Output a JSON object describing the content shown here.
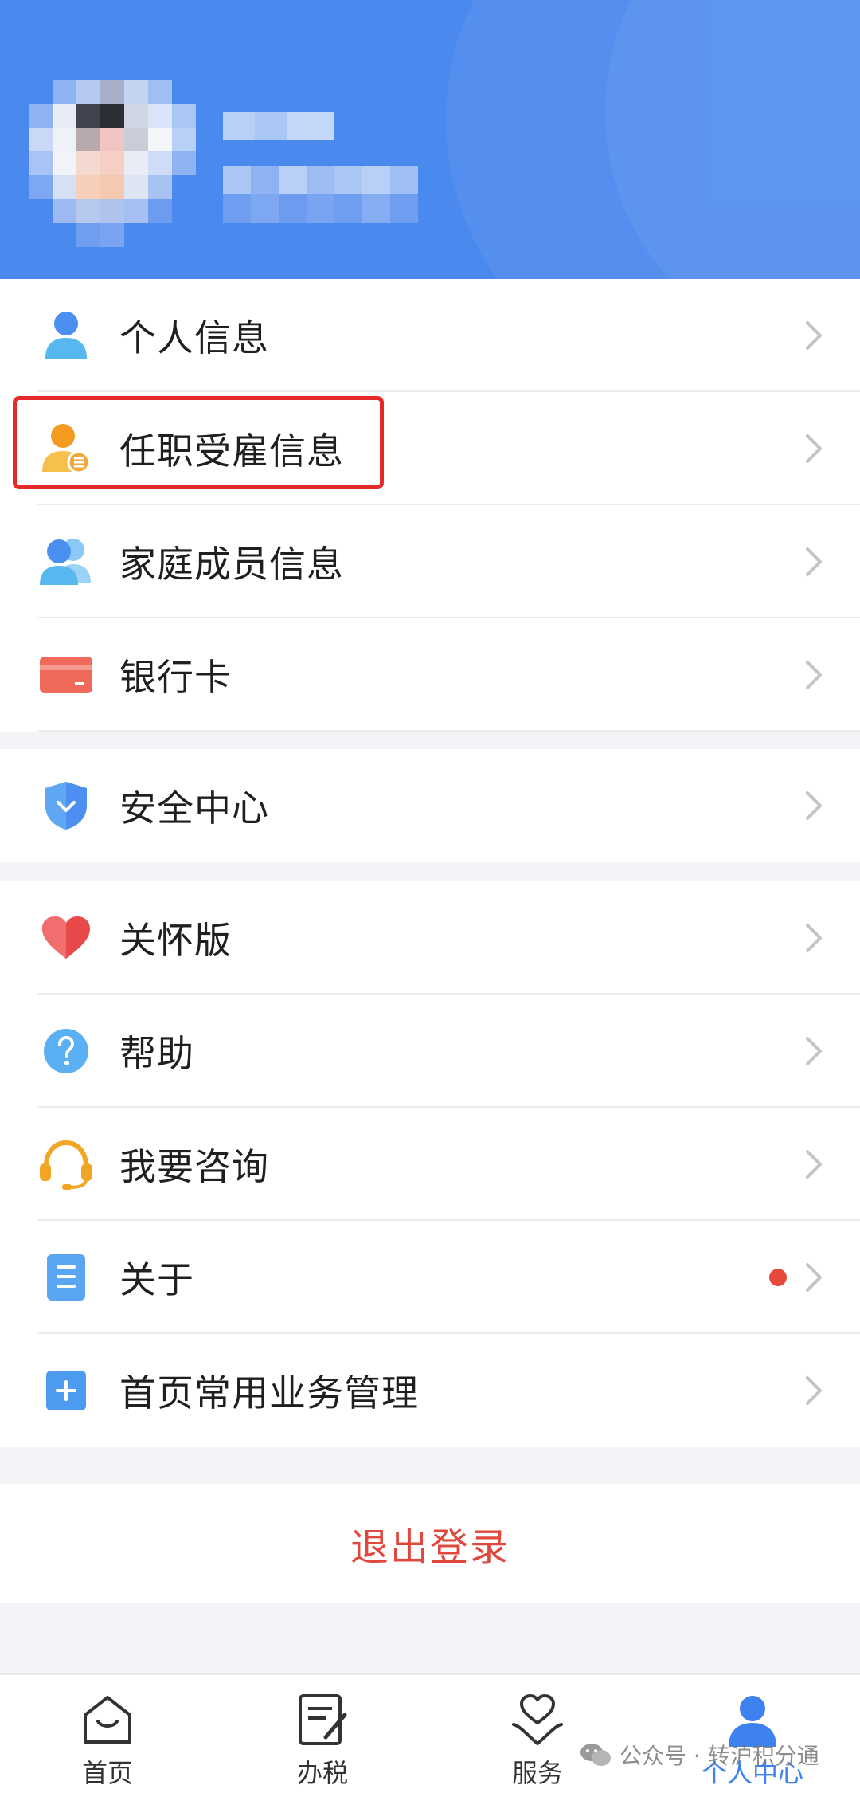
{
  "header": {
    "avatar_alt": "用户头像（已打码）",
    "name_placeholder": "",
    "sub_placeholder": ""
  },
  "menu": {
    "group1": [
      {
        "label": "个人信息",
        "icon": "person-icon"
      },
      {
        "label": "任职受雇信息",
        "icon": "employment-info-icon"
      },
      {
        "label": "家庭成员信息",
        "icon": "family-members-icon"
      },
      {
        "label": "银行卡",
        "icon": "bank-card-icon"
      }
    ],
    "group2": [
      {
        "label": "安全中心",
        "icon": "shield-icon"
      }
    ],
    "group3": [
      {
        "label": "关怀版",
        "icon": "heart-icon"
      },
      {
        "label": "帮助",
        "icon": "help-icon"
      },
      {
        "label": "我要咨询",
        "icon": "headset-icon"
      },
      {
        "label": "关于",
        "icon": "document-icon",
        "badge": "red-dot"
      },
      {
        "label": "首页常用业务管理",
        "icon": "plus-square-icon"
      }
    ]
  },
  "logout": {
    "label": "退出登录"
  },
  "tabbar": {
    "items": [
      {
        "label": "首页",
        "icon": "home-icon"
      },
      {
        "label": "办税",
        "icon": "tax-form-icon"
      },
      {
        "label": "服务",
        "icon": "service-heart-icon"
      },
      {
        "label": "个人中心",
        "icon": "profile-icon",
        "active": true
      }
    ]
  },
  "watermark": {
    "text": "公众号 · 转沪积分通"
  },
  "colors": {
    "header_bg": "#4a89ee",
    "accent": "#3d82ee",
    "logout": "#e0483d",
    "highlight_border": "#e52a2a"
  }
}
